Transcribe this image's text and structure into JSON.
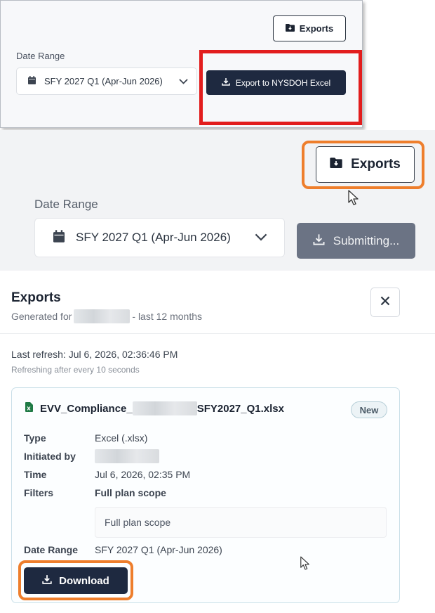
{
  "panel1": {
    "exports_label": "Exports",
    "date_range_label": "Date Range",
    "date_range_value": "SFY 2027 Q1 (Apr-Jun 2026)",
    "export_excel_label": "Export to NYSDOH Excel",
    "highlight_color": "#e21d1d"
  },
  "panel2": {
    "exports_label": "Exports",
    "date_range_label": "Date Range",
    "date_range_value": "SFY 2027 Q1 (Apr-Jun 2026)",
    "submitting_label": "Submitting...",
    "highlight_color": "#ee7e2c"
  },
  "exports_panel": {
    "title": "Exports",
    "generated_prefix": "Generated for",
    "generated_suffix": "- last 12 months",
    "last_refresh": "Last refresh: Jul 6, 2026, 02:36:46 PM",
    "refresh_note": "Refreshing after every 10 seconds",
    "card": {
      "filename_prefix": "EVV_Compliance_",
      "filename_suffix": "SFY2027_Q1.xlsx",
      "badge": "New",
      "type_label": "Type",
      "type_value": "Excel (.xlsx)",
      "initiated_label": "Initiated by",
      "time_label": "Time",
      "time_value": "Jul 6, 2026, 02:35 PM",
      "filters_label": "Filters",
      "filters_value": "Full plan scope",
      "filters_box": "Full plan scope",
      "date_range_label": "Date Range",
      "date_range_value": "SFY 2027 Q1 (Apr-Jun 2026)",
      "download_label": "Download"
    }
  },
  "colors": {
    "primary_dark": "#1e2940",
    "disabled_button": "#6b7384",
    "excel_green": "#1f7a45"
  }
}
